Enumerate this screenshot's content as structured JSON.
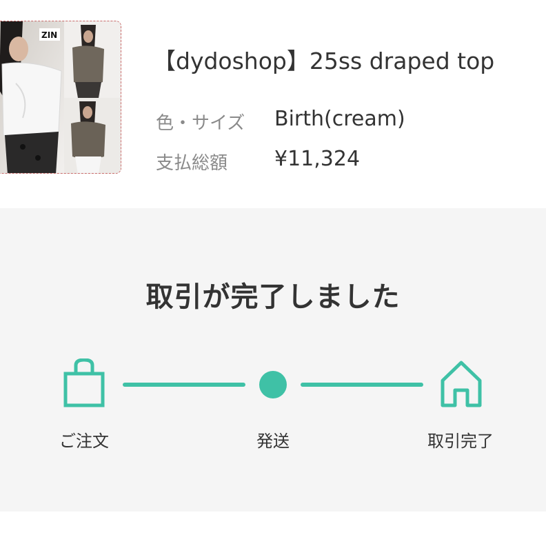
{
  "product": {
    "title": "【dydoshop】25ss draped top",
    "size_label": "色・サイズ",
    "size_value": "Birth(cream)",
    "price_label": "支払総額",
    "price_value": "¥11,324",
    "thumbnail_logo": "ZIN"
  },
  "status": {
    "heading": "取引が完了しました",
    "steps": [
      {
        "label": "ご注文",
        "icon": "shopping-bag-icon"
      },
      {
        "label": "発送",
        "icon": "progress-dot"
      },
      {
        "label": "取引完了",
        "icon": "home-icon"
      }
    ]
  },
  "colors": {
    "accent": "#3fc1a6",
    "section_bg": "#f5f5f5",
    "text": "#333333",
    "muted": "#8a8a8a"
  }
}
